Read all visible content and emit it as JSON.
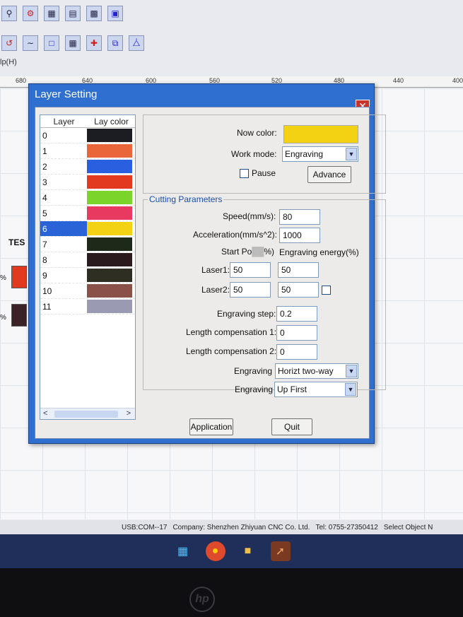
{
  "menu_hint": "lp(H)",
  "ruler": [
    "680",
    "640",
    "600",
    "560",
    "520",
    "480",
    "440",
    "400"
  ],
  "left_panel": {
    "label": "TES",
    "pct1": "%",
    "pct2": "%"
  },
  "dialog": {
    "title": "Layer Setting",
    "layer_list": {
      "col_layer": "Layer",
      "col_color": "Lay color",
      "rows": [
        {
          "num": "0",
          "color": "#1c1d22"
        },
        {
          "num": "1",
          "color": "#e8663a"
        },
        {
          "num": "2",
          "color": "#2a5fe0"
        },
        {
          "num": "3",
          "color": "#e23a1e"
        },
        {
          "num": "4",
          "color": "#7ad42a"
        },
        {
          "num": "5",
          "color": "#e83a60"
        },
        {
          "num": "6",
          "color": "#f3d214"
        },
        {
          "num": "7",
          "color": "#1d2a1a"
        },
        {
          "num": "8",
          "color": "#2a1a1e"
        },
        {
          "num": "9",
          "color": "#2e2f22"
        },
        {
          "num": "10",
          "color": "#8a5148"
        },
        {
          "num": "11",
          "color": "#9a9ab2"
        }
      ],
      "selected_index": 6,
      "scroll_left": "<",
      "scroll_right": ">"
    },
    "now_color_label": "Now color:",
    "now_color": "#f3d214",
    "work_mode_label": "Work mode:",
    "work_mode_value": "Engraving",
    "pause_label": "Pause",
    "advance_label": "Advance",
    "cutting_legend": "Cutting Parameters",
    "speed_label": "Speed(mm/s):",
    "speed_value": "80",
    "accel_label": "Acceleration(mm/s^2):",
    "accel_value": "1000",
    "start_power_label": "Start Po",
    "start_power_suffix": "%)",
    "engraving_energy_label": "Engraving energy(%)",
    "laser1_label": "Laser1:",
    "laser1_power": "50",
    "laser1_energy": "50",
    "laser2_label": "Laser2:",
    "laser2_power": "50",
    "laser2_energy": "50",
    "engraving_step_label": "Engraving step:",
    "engraving_step_value": "0.2",
    "length_comp1_label": "Length compensation 1:",
    "length_comp1_value": "0",
    "length_comp2_label": "Length compensation 2:",
    "length_comp2_value": "0",
    "engraving_dir_label": "Engraving",
    "engraving_dir_value": "Horizt two-way",
    "engraving_order_label": "Engraving",
    "engraving_order_value": "Up First",
    "application_label": "Application",
    "quit_label": "Quit"
  },
  "statusbar": {
    "port": "USB:COM--17",
    "company": "Company: Shenzhen Zhiyuan CNC Co. Ltd.",
    "tel": "Tel: 0755-27350412",
    "select": "Select Object N"
  },
  "icons": [
    "search-icon",
    "gear-icon",
    "grid-icon",
    "table-icon",
    "undo-icon",
    "chrome-icon",
    "folder-icon",
    "laser-app-icon",
    "windows-start-icon"
  ],
  "brand_logo": "hp"
}
